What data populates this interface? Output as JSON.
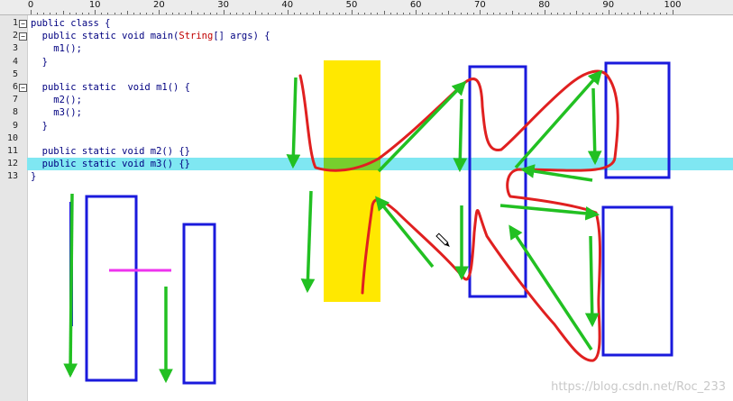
{
  "ruler": {
    "labels": [
      "0",
      "10",
      "20",
      "30",
      "40",
      "50",
      "60",
      "70",
      "80",
      "90",
      "100"
    ]
  },
  "code": {
    "lines": [
      {
        "num": "1",
        "fold": "−",
        "text": "public class {"
      },
      {
        "num": "2",
        "fold": "−",
        "pre": "  public static void main(",
        "str": "String",
        "post": "[] args) {"
      },
      {
        "num": "3",
        "fold": "",
        "text": "    m1();"
      },
      {
        "num": "4",
        "fold": "",
        "text": "  }"
      },
      {
        "num": "5",
        "fold": "",
        "text": ""
      },
      {
        "num": "6",
        "fold": "−",
        "text": "  public static  void m1() {"
      },
      {
        "num": "7",
        "fold": "",
        "text": "    m2();"
      },
      {
        "num": "8",
        "fold": "",
        "text": "    m3();"
      },
      {
        "num": "9",
        "fold": "",
        "text": "  }"
      },
      {
        "num": "10",
        "fold": "",
        "text": ""
      },
      {
        "num": "11",
        "fold": "",
        "text": "  public static void m2() {}"
      },
      {
        "num": "12",
        "fold": "",
        "text": "  public static void m3() {}"
      },
      {
        "num": "13",
        "fold": "",
        "text": "}"
      }
    ],
    "highlighted_line": "12"
  },
  "colors": {
    "line_highlight": "#7fe7f2",
    "box": "#1a1adc",
    "arrow": "#22c022",
    "red_path": "#e02020",
    "yellow_band": "#ffe800",
    "magenta": "#ee33ee"
  },
  "icons": {
    "cursor": "pencil-cursor-icon"
  },
  "watermark": "https://blog.csdn.net/Roc_233"
}
